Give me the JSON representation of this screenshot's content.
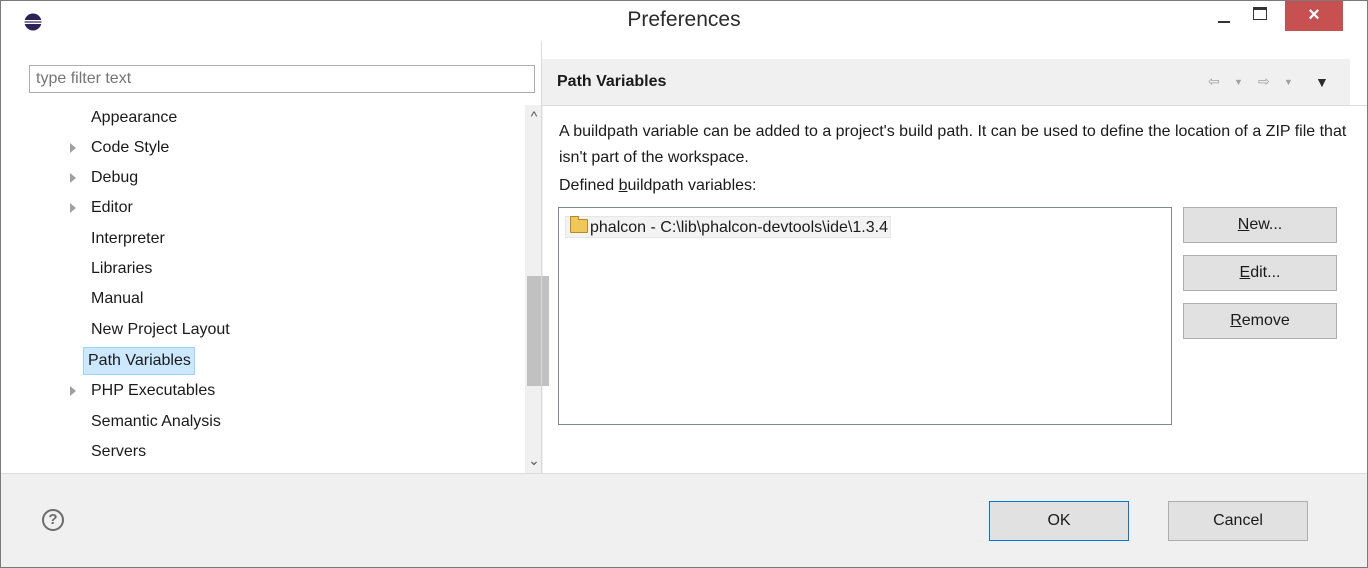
{
  "window": {
    "title": "Preferences",
    "close_glyph": "×",
    "app_icon": "eclipse-icon"
  },
  "filter": {
    "placeholder": "type filter text",
    "value": ""
  },
  "tree": {
    "items": [
      {
        "label": "Appearance",
        "expandable": false,
        "selected": false
      },
      {
        "label": "Code Style",
        "expandable": true,
        "selected": false
      },
      {
        "label": "Debug",
        "expandable": true,
        "selected": false
      },
      {
        "label": "Editor",
        "expandable": true,
        "selected": false
      },
      {
        "label": "Interpreter",
        "expandable": false,
        "selected": false
      },
      {
        "label": "Libraries",
        "expandable": false,
        "selected": false
      },
      {
        "label": "Manual",
        "expandable": false,
        "selected": false
      },
      {
        "label": "New Project Layout",
        "expandable": false,
        "selected": false
      },
      {
        "label": "Path Variables",
        "expandable": false,
        "selected": true
      },
      {
        "label": "PHP Executables",
        "expandable": true,
        "selected": false
      },
      {
        "label": "Semantic Analysis",
        "expandable": false,
        "selected": false
      },
      {
        "label": "Servers",
        "expandable": false,
        "selected": false
      }
    ],
    "scroll_up_glyph": "^",
    "scroll_down_glyph": "⌄"
  },
  "page": {
    "title": "Path Variables",
    "nav_back_glyph": "⇦",
    "nav_fwd_glyph": "⇨",
    "menu_glyph": "▼",
    "description": "A buildpath variable can be added to a project's build path. It can be used to define the location of a ZIP file that isn't part of the workspace.",
    "defined_label_pre": "Defined ",
    "defined_label_mnemonic": "b",
    "defined_label_post": "uildpath variables:",
    "variables": [
      {
        "text": "phalcon - C:\\lib\\phalcon-devtools\\ide\\1.3.4",
        "icon": "folder-open-icon"
      }
    ],
    "buttons": {
      "new_mnemonic": "N",
      "new_rest": "ew...",
      "edit_mnemonic": "E",
      "edit_rest": "dit...",
      "remove_mnemonic": "R",
      "remove_rest": "emove"
    }
  },
  "footer": {
    "help_glyph": "?",
    "ok_label": "OK",
    "cancel_label": "Cancel"
  },
  "colors": {
    "accent": "#0078d7",
    "close_button": "#c75050",
    "selection": "#cce8ff"
  }
}
